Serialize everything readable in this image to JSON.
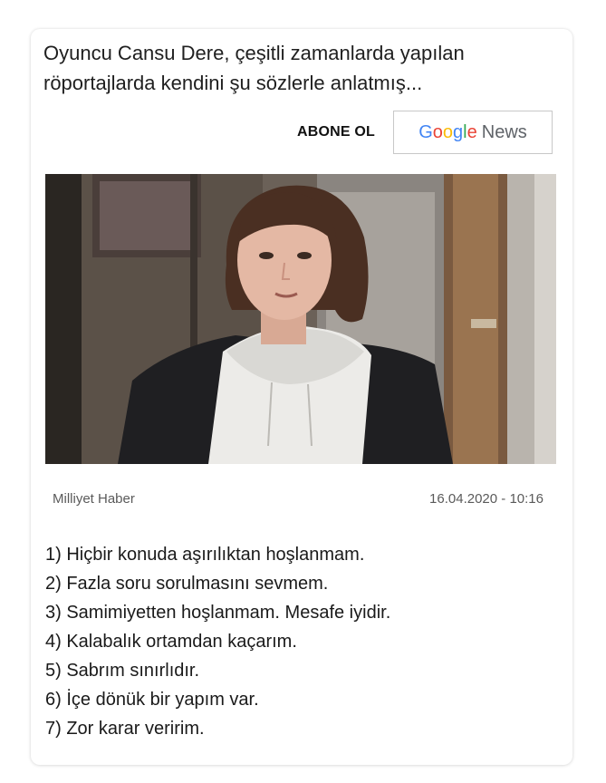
{
  "headline": "Oyuncu Cansu Dere, çeşitli zamanlarda yapılan röportajlarda kendini şu sözlerle anlatmış...",
  "subscribe": {
    "label": "ABONE OL",
    "button": {
      "google_G": "G",
      "google_o1": "o",
      "google_o2": "o",
      "google_g": "g",
      "google_l": "l",
      "google_e": "e",
      "news": "News"
    }
  },
  "photo": {
    "icon": "news-photo"
  },
  "meta": {
    "source": "Milliyet Haber",
    "date": "16.04.2020 - 10:16"
  },
  "items": [
    "1) Hiçbir konuda aşırılıktan hoşlanmam.",
    "2) Fazla soru sorulmasını sevmem.",
    "3) Samimiyetten hoşlanmam. Mesafe iyidir.",
    "4) Kalabalık ortamdan kaçarım.",
    "5) Sabrım sınırlıdır.",
    "6) İçe dönük bir yapım var.",
    "7) Zor karar veririm."
  ],
  "colors": {
    "google_blue": "#4285F4",
    "google_red": "#EA4335",
    "google_yellow": "#FBBC05",
    "google_green": "#34A853"
  }
}
